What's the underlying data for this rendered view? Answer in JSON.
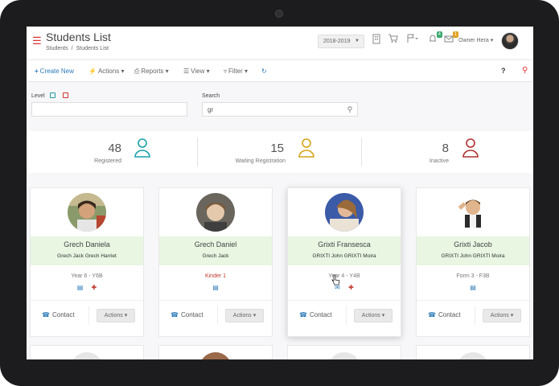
{
  "header": {
    "title": "Students List",
    "breadcrumb": [
      "Students",
      "/",
      "Students List"
    ],
    "year": "2018-2019",
    "owner": "Owner Hera",
    "badge_left": "4",
    "badge_right": "1"
  },
  "toolbar": {
    "create": "Create New",
    "actions": "Actions",
    "reports": "Reports",
    "view": "View",
    "filter": "Filter",
    "help": "?"
  },
  "filters": {
    "level_label": "Level",
    "search_label": "Search",
    "search_value": "gr"
  },
  "stats": [
    {
      "value": "48",
      "label": "Registered",
      "color": "#1aa0a8"
    },
    {
      "value": "15",
      "label": "Waiting Registration",
      "color": "#d4a21a"
    },
    {
      "value": "8",
      "label": "Inactive",
      "color": "#b03030"
    }
  ],
  "cards": [
    {
      "name": "Grech Daniela",
      "parents": "Grech Jack Grech Harriet",
      "class": "Year 6 - Y6B",
      "contact": "Contact",
      "actions": "Actions"
    },
    {
      "name": "Grech Daniel",
      "parents": "Grech Jack",
      "class": "Kinder 1",
      "contact": "Contact",
      "actions": "Actions"
    },
    {
      "name": "Grixti Fransesca",
      "parents": "GRIXTI John GRIXTI Moira",
      "class": "Year 4 - Y4B",
      "contact": "Contact",
      "actions": "Actions"
    },
    {
      "name": "Grixti Jacob",
      "parents": "GRIXTI John GRIXTI Moira",
      "class": "Form 3 - F3B",
      "contact": "Contact",
      "actions": "Actions"
    }
  ],
  "colors": {
    "accent": "#2a7ab8",
    "name_band": "#e8f6e2",
    "menu_red": "#d33333"
  }
}
